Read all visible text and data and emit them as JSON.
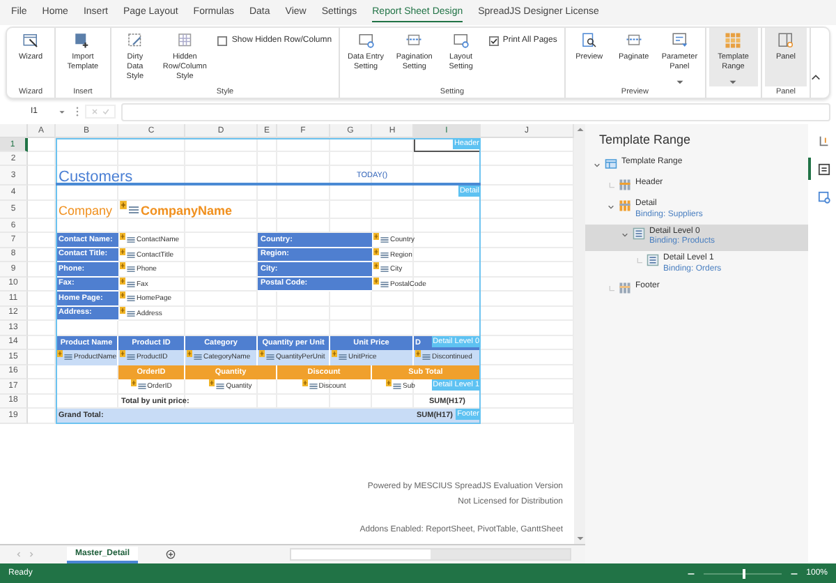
{
  "menu_tabs": [
    {
      "label": "File",
      "selected": false
    },
    {
      "label": "Home",
      "selected": false
    },
    {
      "label": "Insert",
      "selected": false
    },
    {
      "label": "Page Layout",
      "selected": false
    },
    {
      "label": "Formulas",
      "selected": false
    },
    {
      "label": "Data",
      "selected": false
    },
    {
      "label": "View",
      "selected": false
    },
    {
      "label": "Settings",
      "selected": false
    },
    {
      "label": "Report Sheet Design",
      "selected": true
    },
    {
      "label": "SpreadJS Designer License",
      "selected": false
    }
  ],
  "ribbon": {
    "groups": [
      {
        "label": "Wizard",
        "items": [
          {
            "kind": "button",
            "label": "Wizard",
            "on": false
          }
        ]
      },
      {
        "label": "Insert",
        "items": [
          {
            "kind": "button",
            "label": "Import Template",
            "on": false
          }
        ]
      },
      {
        "label": "Style",
        "items": [
          {
            "kind": "button",
            "label": "Dirty Data Style",
            "on": false
          },
          {
            "kind": "button",
            "label": "Hidden Row/Column Style",
            "on": false
          },
          {
            "kind": "checkbox",
            "label": "Show Hidden Row/Column",
            "checked": false
          }
        ]
      },
      {
        "label": "Setting",
        "items": [
          {
            "kind": "button",
            "label": "Data Entry Setting",
            "on": false
          },
          {
            "kind": "button",
            "label": "Pagination Setting",
            "on": false
          },
          {
            "kind": "button",
            "label": "Layout Setting",
            "on": false
          },
          {
            "kind": "checkbox",
            "label": "Print All Pages",
            "checked": true
          }
        ]
      },
      {
        "label": "Preview",
        "items": [
          {
            "kind": "button",
            "label": "Preview",
            "on": false
          },
          {
            "kind": "button",
            "label": "Paginate",
            "on": false
          },
          {
            "kind": "button",
            "label": "Parameter Panel",
            "on": false,
            "dropdown": true
          }
        ]
      },
      {
        "items": [
          {
            "kind": "button",
            "label": "Template Range",
            "on": true,
            "dropdown": true
          }
        ]
      },
      {
        "label": "Panel",
        "items": [
          {
            "kind": "button",
            "label": "Panel",
            "on": true
          }
        ]
      }
    ]
  },
  "formula_bar": {
    "name_box": "I1"
  },
  "sheet": {
    "columns": [
      {
        "label": "A",
        "selected": false
      },
      {
        "label": "B",
        "selected": false
      },
      {
        "label": "C",
        "selected": false
      },
      {
        "label": "D",
        "selected": false
      },
      {
        "label": "E",
        "selected": false
      },
      {
        "label": "F",
        "selected": false
      },
      {
        "label": "G",
        "selected": false
      },
      {
        "label": "H",
        "selected": false
      },
      {
        "label": "I",
        "selected": true
      },
      {
        "label": "J",
        "selected": false
      }
    ],
    "rows": [
      {
        "number": "1",
        "selected": true,
        "tag": "Header",
        "cells": []
      },
      {
        "number": "2",
        "selected": false,
        "cells": []
      },
      {
        "number": "3",
        "selected": false,
        "cells": [
          {
            "kind": "empty",
            "text": ""
          },
          {
            "kind": "title",
            "text": "Customers"
          },
          {
            "kind": "date",
            "text": "TODAY()"
          }
        ]
      },
      {
        "number": "4",
        "selected": false,
        "tag": "Detail",
        "cells": []
      },
      {
        "number": "5",
        "selected": false,
        "cells": [
          {
            "kind": "empty",
            "text": ""
          },
          {
            "kind": "company",
            "text": "Company"
          },
          {
            "kind": "company_field",
            "text": "CompanyName"
          }
        ]
      },
      {
        "number": "6",
        "selected": false,
        "cells": []
      },
      {
        "number": "7",
        "selected": false,
        "cells": [
          {
            "kind": "empty",
            "text": ""
          },
          {
            "kind": "label",
            "text": "Contact Name:"
          },
          {
            "kind": "field",
            "text": "ContactName"
          },
          {
            "kind": "label",
            "text": "Country:"
          },
          {
            "kind": "field",
            "text": "Country"
          }
        ]
      },
      {
        "number": "8",
        "selected": false,
        "cells": [
          {
            "kind": "empty",
            "text": ""
          },
          {
            "kind": "label",
            "text": "Contact Title:"
          },
          {
            "kind": "field",
            "text": "ContactTitle"
          },
          {
            "kind": "label",
            "text": "Region:"
          },
          {
            "kind": "field",
            "text": "Region"
          }
        ]
      },
      {
        "number": "9",
        "selected": false,
        "cells": [
          {
            "kind": "empty",
            "text": ""
          },
          {
            "kind": "label",
            "text": "Phone:"
          },
          {
            "kind": "field",
            "text": "Phone"
          },
          {
            "kind": "label",
            "text": "City:"
          },
          {
            "kind": "field",
            "text": "City"
          }
        ]
      },
      {
        "number": "10",
        "selected": false,
        "cells": [
          {
            "kind": "empty",
            "text": ""
          },
          {
            "kind": "label",
            "text": "Fax:"
          },
          {
            "kind": "field",
            "text": "Fax"
          },
          {
            "kind": "label",
            "text": "Postal Code:"
          },
          {
            "kind": "field",
            "text": "PostalCode"
          }
        ]
      },
      {
        "number": "11",
        "selected": false,
        "cells": [
          {
            "kind": "empty",
            "text": ""
          },
          {
            "kind": "label",
            "text": "Home Page:"
          },
          {
            "kind": "field",
            "text": "HomePage"
          }
        ]
      },
      {
        "number": "12",
        "selected": false,
        "cells": [
          {
            "kind": "empty",
            "text": ""
          },
          {
            "kind": "label",
            "text": "Address:"
          },
          {
            "kind": "field",
            "text": "Address"
          }
        ]
      },
      {
        "number": "13",
        "selected": false,
        "cells": []
      },
      {
        "number": "14",
        "selected": false,
        "tag": "Detail Level 0",
        "cells": [
          {
            "kind": "empty",
            "text": ""
          },
          {
            "kind": "head",
            "text": "Product Name"
          },
          {
            "kind": "head",
            "text": "Product ID"
          },
          {
            "kind": "head",
            "text": "Category"
          },
          {
            "kind": "head",
            "text": "Quantity per Unit"
          },
          {
            "kind": "head",
            "text": "Unit Price"
          },
          {
            "kind": "head_partial",
            "text": "D"
          }
        ]
      },
      {
        "number": "15",
        "selected": false,
        "cells": [
          {
            "kind": "empty",
            "text": ""
          },
          {
            "kind": "field_light",
            "text": "ProductName"
          },
          {
            "kind": "field_light",
            "text": "ProductID"
          },
          {
            "kind": "field_light",
            "text": "CategoryName"
          },
          {
            "kind": "field_light",
            "text": "QuantityPerUnit"
          },
          {
            "kind": "empty",
            "text": ""
          },
          {
            "kind": "field_light",
            "text": "UnitPrice"
          },
          {
            "kind": "empty",
            "text": ""
          },
          {
            "kind": "field_light",
            "text": "Discontinued"
          }
        ]
      },
      {
        "number": "16",
        "selected": false,
        "cells": [
          {
            "kind": "empty",
            "text": ""
          },
          {
            "kind": "empty",
            "text": ""
          },
          {
            "kind": "orange_head",
            "text": "OrderID"
          },
          {
            "kind": "orange_head",
            "text": "Quantity"
          },
          {
            "kind": "orange_head",
            "text": "Discount"
          },
          {
            "kind": "orange_head",
            "text": "Sub Total"
          }
        ]
      },
      {
        "number": "17",
        "selected": false,
        "cells": [
          {
            "kind": "empty",
            "text": ""
          },
          {
            "kind": "empty",
            "text": ""
          },
          {
            "kind": "field_center",
            "text": "OrderID"
          },
          {
            "kind": "field_center",
            "text": "Quantity"
          },
          {
            "kind": "field_center",
            "text": "Discount"
          },
          {
            "kind": "field_partial",
            "text": "Sub"
          }
        ],
        "tag": "Detail Level 1"
      },
      {
        "number": "18",
        "selected": false,
        "cells": [
          {
            "kind": "empty",
            "text": ""
          },
          {
            "kind": "empty",
            "text": ""
          },
          {
            "kind": "total",
            "text": "Total by unit price:"
          },
          {
            "kind": "empty",
            "text": ""
          },
          {
            "kind": "empty",
            "text": ""
          },
          {
            "kind": "empty",
            "text": ""
          },
          {
            "kind": "empty",
            "text": ""
          },
          {
            "kind": "empty",
            "text": ""
          },
          {
            "kind": "sum",
            "text": "SUM(H17)"
          }
        ]
      },
      {
        "number": "19",
        "selected": false,
        "cells": [
          {
            "kind": "empty",
            "text": ""
          },
          {
            "kind": "grand",
            "text": "Grand Total:"
          },
          {
            "kind": "empty",
            "text": ""
          },
          {
            "kind": "empty",
            "text": ""
          },
          {
            "kind": "empty",
            "text": ""
          },
          {
            "kind": "empty",
            "text": ""
          },
          {
            "kind": "empty",
            "text": ""
          },
          {
            "kind": "empty",
            "text": ""
          },
          {
            "kind": "grand_sum",
            "text": "SUM(H17)"
          }
        ],
        "tag": "Footer"
      }
    ],
    "notice": [
      "Powered by MESCIUS SpreadJS Evaluation Version",
      "Not Licensed for Distribution",
      "Addons Enabled: ReportSheet, PivotTable, GanttSheet"
    ]
  },
  "sheet_tabs": [
    {
      "label": "Master_Detail",
      "selected": true
    }
  ],
  "panel": {
    "title": "Template Range",
    "tree": [
      {
        "label": "Template Range",
        "kind": "range",
        "expanded": true,
        "selected": false,
        "children": [
          {
            "label": "Header",
            "kind": "header",
            "selected": false
          },
          {
            "label": "Detail",
            "binding": "Binding: Suppliers",
            "kind": "detail",
            "expanded": true,
            "selected": false,
            "children": [
              {
                "label": "Detail Level 0",
                "binding": "Binding: Products",
                "kind": "level",
                "expanded": true,
                "selected": true,
                "children": [
                  {
                    "label": "Detail Level 1",
                    "binding": "Binding: Orders",
                    "kind": "level",
                    "selected": false
                  }
                ]
              }
            ]
          },
          {
            "label": "Footer",
            "kind": "footer",
            "selected": false
          }
        ]
      }
    ]
  },
  "side_tabs": [
    {
      "selected": false
    },
    {
      "selected": true
    },
    {
      "selected": false
    }
  ],
  "status_bar": {
    "text": "Ready",
    "zoom": {
      "level": 0.5,
      "reading": "100%"
    }
  }
}
